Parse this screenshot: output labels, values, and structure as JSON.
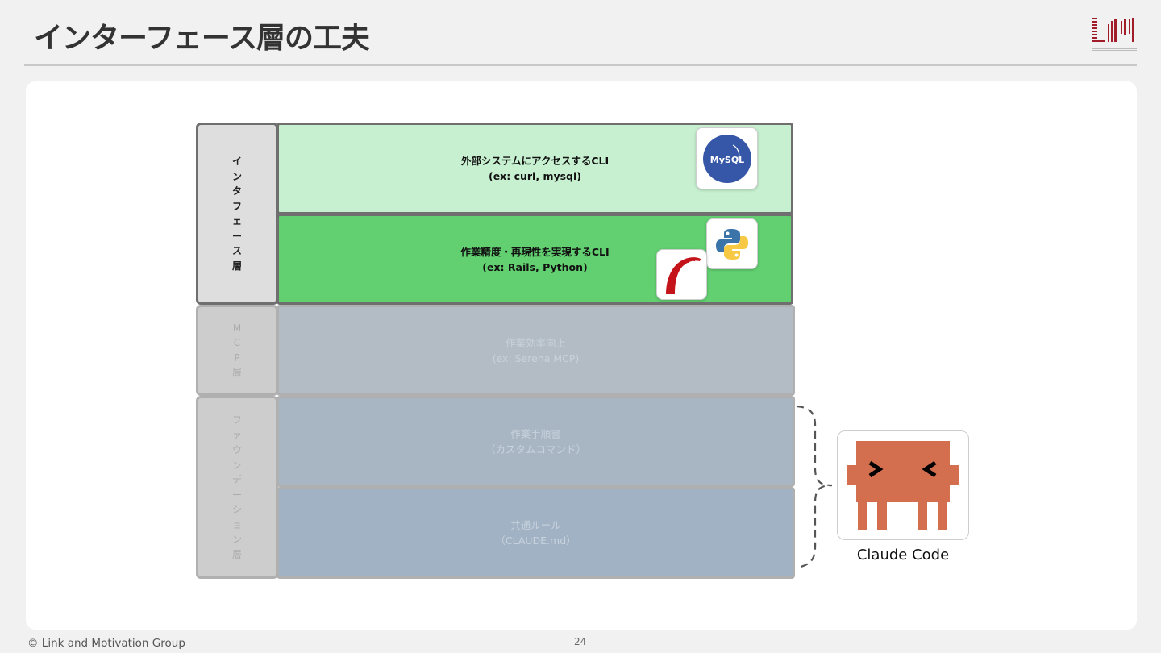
{
  "slide": {
    "title": "インターフェース層の工夫",
    "footer": "© Link and Motivation Group",
    "page_number": "24"
  },
  "side_labels": [
    {
      "name": "interface-layer-label",
      "chars": [
        "イ",
        "ン",
        "タ",
        "フ",
        "ェ",
        "ー",
        "ス",
        "層"
      ],
      "active": true
    },
    {
      "name": "mcp-layer-label",
      "chars": [
        "M",
        "C",
        "P",
        "層"
      ],
      "active": false
    },
    {
      "name": "foundation-layer-label",
      "chars": [
        "フ",
        "ァ",
        "ウ",
        "ン",
        "デ",
        "ー",
        "シ",
        "ョ",
        "ン",
        "層"
      ],
      "active": false
    }
  ],
  "layers": [
    {
      "name": "external-cli-layer",
      "line1": "外部システムにアクセスするCLI",
      "line2": "(ex: curl, mysql)",
      "color": "#c7f0d0",
      "active": true
    },
    {
      "name": "precision-cli-layer",
      "line1": "作業精度・再現性を実現するCLI",
      "line2": "(ex: Rails, Python)",
      "color": "#62cf71",
      "active": true
    },
    {
      "name": "mcp-efficiency-layer",
      "line1": "作業効率向上",
      "line2": "(ex: Serena MCP)",
      "color": "#b3bcc5",
      "active": false
    },
    {
      "name": "procedures-layer",
      "line1": "作業手順書",
      "line2": "（カスタムコマンド）",
      "color": "#a8b6c3",
      "active": false
    },
    {
      "name": "common-rules-layer",
      "line1": "共通ルール",
      "line2": "（CLAUDE.md）",
      "color": "#a1b2c4",
      "active": false
    }
  ],
  "icons": {
    "mysql_text": "MySQL",
    "mysql": "mysql-logo-icon",
    "python": "python-logo-icon",
    "rails": "rails-logo-icon",
    "claude": "claude-code-mascot-icon",
    "logo": "company-logo-icon"
  },
  "claude": {
    "label": "Claude Code",
    "color": "#d36f4f"
  },
  "colors": {
    "mysql_circle": "#3657a7",
    "python_blue": "#3a74a8",
    "python_yellow": "#f7c843",
    "rails_red": "#c5131a",
    "logo_red": "#a11d2a"
  }
}
